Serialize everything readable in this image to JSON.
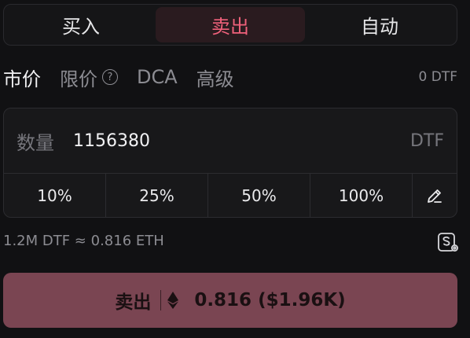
{
  "side_tabs": [
    "买入",
    "卖出",
    "自动"
  ],
  "active_side": "卖出",
  "order_types": {
    "market": "市价",
    "limit": "限价",
    "dca": "DCA",
    "advanced": "高级",
    "balance": "0 DTF"
  },
  "quantity": {
    "label": "数量",
    "value": "1156380",
    "unit": "DTF"
  },
  "percent_buttons": [
    "10%",
    "25%",
    "50%",
    "100%"
  ],
  "conversion": "1.2M DTF ≈ 0.816 ETH",
  "submit": {
    "label": "卖出",
    "amount": "0.816 ($1.96K)"
  },
  "colors": {
    "accent_red": "#f0617b",
    "sell_button": "#7a4552"
  },
  "icons": [
    "help-icon",
    "edit-pencil-icon",
    "slippage-settings-icon",
    "eth-icon"
  ]
}
